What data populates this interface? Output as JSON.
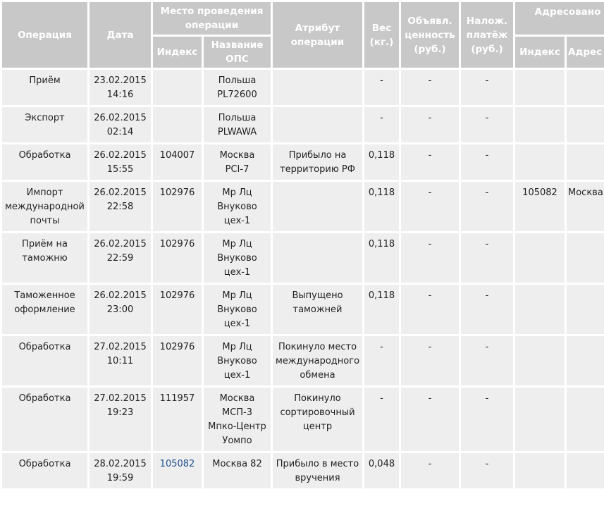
{
  "header": {
    "operation": "Операция",
    "date": "Дата",
    "place": "Место проведения операции",
    "place_index": "Индекс",
    "place_name": "Название ОПС",
    "attribute": "Атрибут операции",
    "weight": "Вес (кг.)",
    "declared": "Объявл. ценность (руб.)",
    "cod": "Налож. платёж (руб.)",
    "addressed": "Адресовано",
    "addr_index": "Индекс",
    "addr_address": "Адрес"
  },
  "rows": [
    {
      "operation": "Приём",
      "date": "23.02.2015\n14:16",
      "index": "",
      "name": "Польша\nPL72600",
      "attribute": "",
      "weight": "-",
      "declared": "-",
      "cod": "-",
      "addr_index": "",
      "addr": ""
    },
    {
      "operation": "Экспорт",
      "date": "26.02.2015\n02:14",
      "index": "",
      "name": "Польша\nPLWAWA",
      "attribute": "",
      "weight": "-",
      "declared": "-",
      "cod": "-",
      "addr_index": "",
      "addr": ""
    },
    {
      "operation": "Обработка",
      "date": "26.02.2015\n15:55",
      "index": "104007",
      "name": "Москва\nPCI-7",
      "attribute": "Прибыло на территорию РФ",
      "weight": "0,118",
      "declared": "-",
      "cod": "-",
      "addr_index": "",
      "addr": ""
    },
    {
      "operation": "Импорт международной почты",
      "date": "26.02.2015\n22:58",
      "index": "102976",
      "name": "Мр Лц\nВнуково\nцех-1",
      "attribute": "",
      "weight": "0,118",
      "declared": "-",
      "cod": "-",
      "addr_index": "105082",
      "addr": "Москва"
    },
    {
      "operation": "Приём на таможню",
      "date": "26.02.2015\n22:59",
      "index": "102976",
      "name": "Мр Лц\nВнуково\nцех-1",
      "attribute": "",
      "weight": "0,118",
      "declared": "-",
      "cod": "-",
      "addr_index": "",
      "addr": ""
    },
    {
      "operation": "Таможенное оформление",
      "date": "26.02.2015\n23:00",
      "index": "102976",
      "name": "Мр Лц\nВнуково\nцех-1",
      "attribute": "Выпущено таможней",
      "weight": "0,118",
      "declared": "-",
      "cod": "-",
      "addr_index": "",
      "addr": ""
    },
    {
      "operation": "Обработка",
      "date": "27.02.2015\n10:11",
      "index": "102976",
      "name": "Мр Лц\nВнуково\nцех-1",
      "attribute": "Покинуло место международного обмена",
      "weight": "-",
      "declared": "-",
      "cod": "-",
      "addr_index": "",
      "addr": ""
    },
    {
      "operation": "Обработка",
      "date": "27.02.2015\n19:23",
      "index": "111957",
      "name": "Москва\nМСП-3\nМпко-Центр\nУомпо",
      "attribute": "Покинуло сортировочный центр",
      "weight": "-",
      "declared": "-",
      "cod": "-",
      "addr_index": "",
      "addr": ""
    },
    {
      "operation": "Обработка",
      "date": "28.02.2015\n19:59",
      "index": "105082",
      "name": "Москва 82",
      "attribute": "Прибыло в место вручения",
      "weight": "0,048",
      "declared": "-",
      "cod": "-",
      "addr_index": "",
      "addr": ""
    }
  ]
}
